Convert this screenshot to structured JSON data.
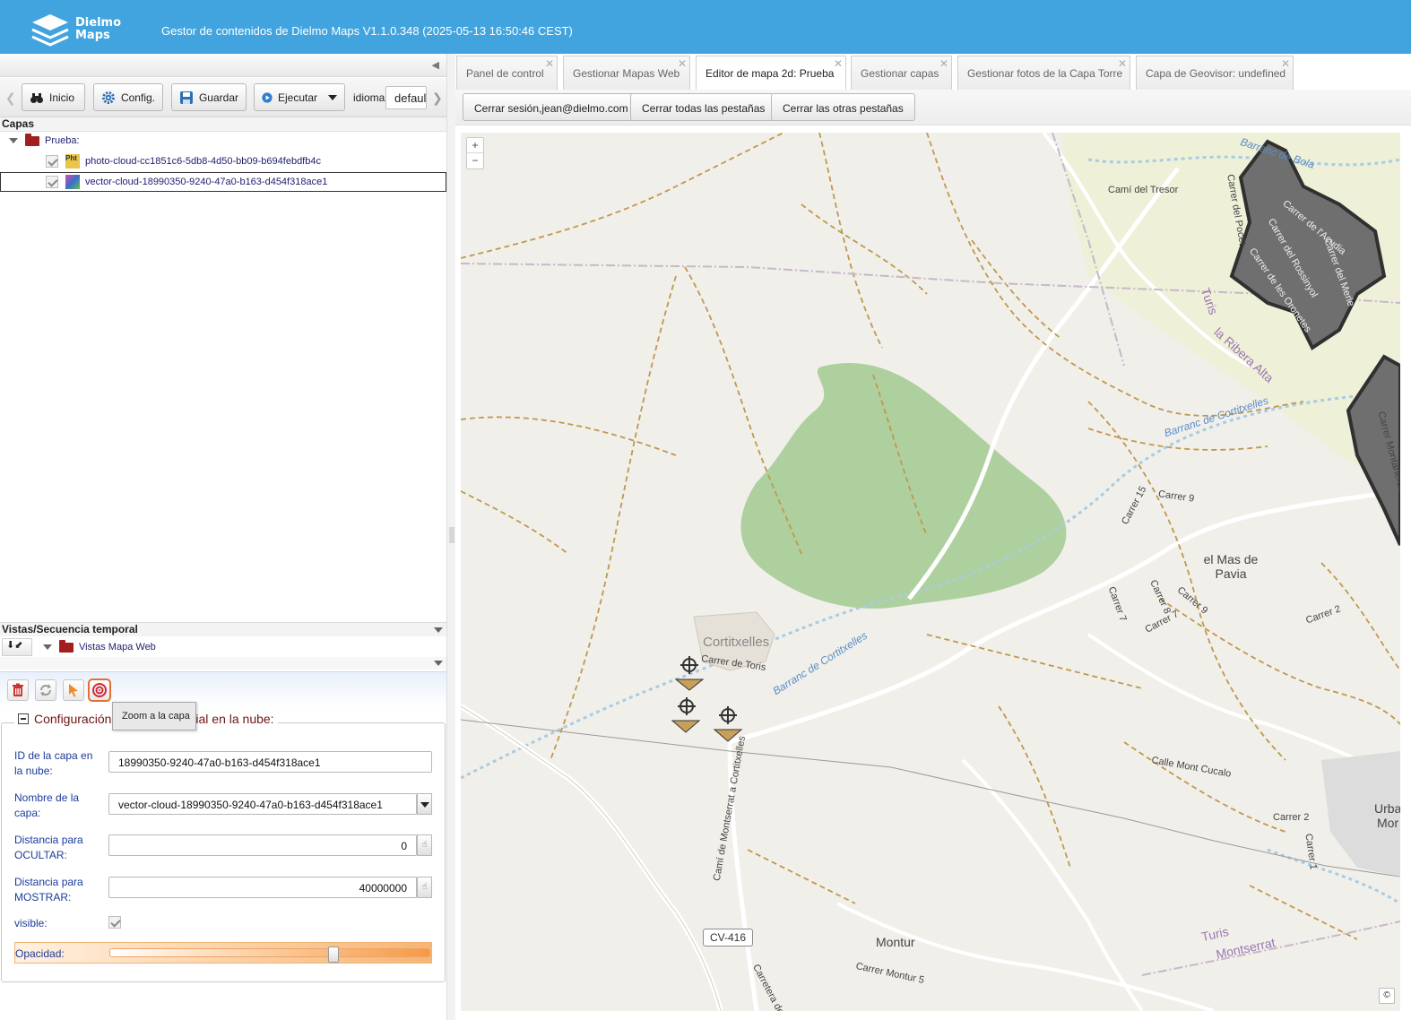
{
  "header": {
    "logo_line1": "Dielmo",
    "logo_line2": "Maps",
    "title": "Gestor de contenidos de Dielmo Maps V1.1.0.348 (2025-05-13 16:50:46 CEST)"
  },
  "toolbar": {
    "inicio": "Inicio",
    "config": "Config.",
    "guardar": "Guardar",
    "ejecutar": "Ejecutar",
    "idioma_label": "idioma:",
    "idioma_value": "default"
  },
  "layers": {
    "title": "Capas",
    "group": "Prueba:",
    "items": [
      {
        "label": "photo-cloud-cc1851c6-5db8-4d50-bb09-b694febdfb4c",
        "icon_text": "Pht"
      },
      {
        "label": "vector-cloud-18990350-9240-47a0-b163-d454f318ace1",
        "icon_text": ""
      }
    ]
  },
  "views": {
    "title": "Vistas/Secuencia temporal",
    "group": "Vistas Mapa Web"
  },
  "tooltip": "Zoom a la capa",
  "form": {
    "legend_start": "Configuración",
    "legend_end": "ial en la nube:",
    "id_label": "ID de la capa en la nube:",
    "id_value": "18990350-9240-47a0-b163-d454f318ace1",
    "name_label": "Nombre de la capa:",
    "name_value": "vector-cloud-18990350-9240-47a0-b163-d454f318ace1",
    "hide_label": "Distancia para OCULTAR:",
    "hide_value": "0",
    "show_label": "Distancia para MOSTRAR:",
    "show_value": "40000000",
    "visible_label": "visible:",
    "visible": true,
    "opacity_label": "Opacidad:",
    "opacity": 0.7
  },
  "tabs": [
    {
      "label": "Panel de control",
      "active": false
    },
    {
      "label": "Gestionar Mapas Web",
      "active": false
    },
    {
      "label": "Editor de mapa 2d: Prueba",
      "active": true
    },
    {
      "label": "Gestionar capas",
      "active": false
    },
    {
      "label": "Gestionar fotos de la Capa Torre",
      "active": false
    },
    {
      "label": "Capa de Geovisor: undefined",
      "active": false
    }
  ],
  "sub_buttons": {
    "logout": "Cerrar sesión,jean@dielmo.com",
    "close_all": "Cerrar todas las pestañas",
    "close_others": "Cerrar las otras pestañas"
  },
  "map": {
    "zoom_in": "+",
    "zoom_out": "−",
    "attribution": "©",
    "labels": {
      "cami_tresor": "Camí del Tresor",
      "barranc_bola": "Barranc de Bola",
      "carrer_pocet": "Carrer del Pocet",
      "carrer_acudia": "Carrer de l'Acudia",
      "carrer_rossinyol": "Carrer del Rossinyol",
      "carrer_oronetes": "Carrer de les Oronetes",
      "carrer_merle": "Carrer del Merle",
      "turis": "Turis",
      "ribera_alta": "la Ribera Alta",
      "barranc_cortitxelles": "Barranc de Cortitxelles",
      "carrer_montaneros": "Carrer Montañeros",
      "carrer15": "Carrer 15",
      "carrer9a": "Carrer 9",
      "mas_pavia": "el Mas de Pavia",
      "carrer7": "Carrer 7",
      "carrer8": "Carrer 8",
      "carrer9b": "Carrer 9",
      "carrer7b": "Carrer 7",
      "carrer2": "Carrer 2",
      "cortitxelles": "Cortitxelles",
      "carrer_toris": "Carrer de Toris",
      "barranc_cortitxelles2": "Barranc de Cortitxelles",
      "calle_mont": "Calle Mont Cucalo",
      "carrer2b": "Carrer 2",
      "carrer1": "Carrer 1",
      "urba": "Urba",
      "mor": "Mor",
      "cami_montserrat": "Camí de Montserrat a Cortitxelles",
      "cv416": "CV-416",
      "montur": "Montur",
      "carrer_montur": "Carrer Montur 5",
      "carretera": "Carretera de",
      "turis2": "Turis",
      "montserrat": "Montserrat"
    }
  },
  "colors": {
    "header": "#41a4de",
    "accent_orange": "#e27033",
    "legend_text": "#6f1515",
    "field_label": "#1b3b9a",
    "forest": "#aed09e",
    "urban": "#6f6f6f"
  }
}
